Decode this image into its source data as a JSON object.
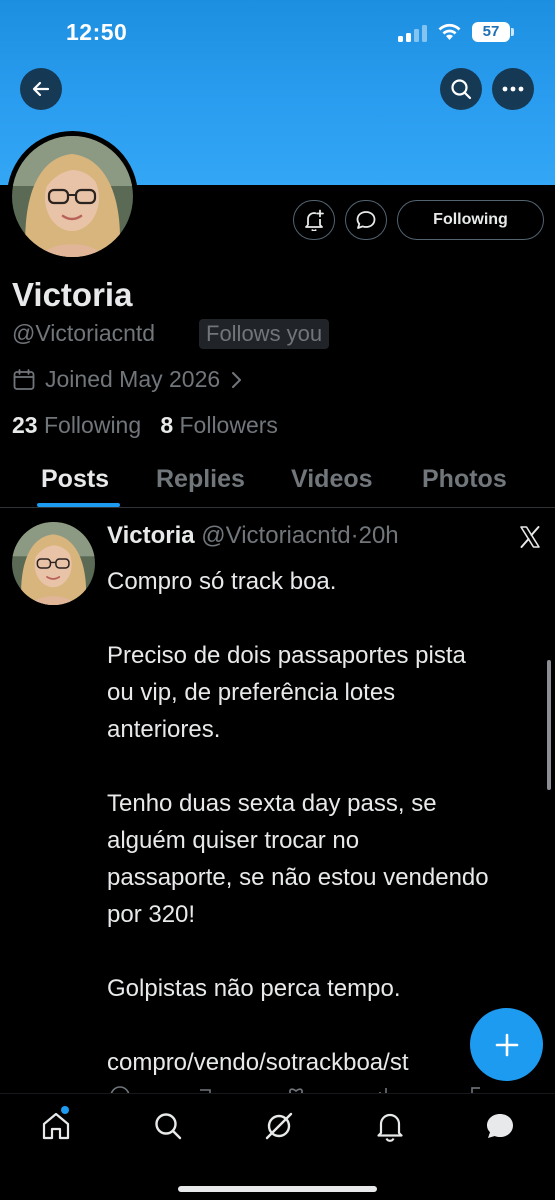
{
  "status_bar": {
    "time": "12:50",
    "battery": "57"
  },
  "header": {
    "back_icon": "arrow-left-icon",
    "search_icon": "search-icon",
    "more_icon": "more-horizontal-icon"
  },
  "profile": {
    "name": "Victoria",
    "handle": "@Victoriacntd",
    "follows_you": "Follows you",
    "joined": "Joined May 2026",
    "following_count": "23",
    "following_label": "Following",
    "followers_count": "8",
    "followers_label": "Followers",
    "follow_button": "Following",
    "notify_icon": "bell-plus-icon",
    "message_icon": "message-bubble-icon"
  },
  "tabs": [
    {
      "label": "Posts",
      "active": true
    },
    {
      "label": "Replies",
      "active": false
    },
    {
      "label": "Videos",
      "active": false
    },
    {
      "label": "Photos",
      "active": false
    }
  ],
  "post": {
    "name": "Victoria",
    "handle": "@Victoriacntd",
    "separator": "·",
    "time": "20h",
    "lines": [
      "Compro só track boa.",
      "",
      "Preciso de dois passaportes pista",
      "ou vip, de preferência lotes",
      "anteriores.",
      "",
      "Tenho duas sexta day pass, se",
      "alguém quiser trocar no",
      "passaporte, se não estou vendendo",
      "por 320!",
      "",
      "Golpistas não perca tempo.",
      "",
      "compro/vendo/sotrackboa/st"
    ]
  },
  "bottom_nav": [
    {
      "name": "home-icon",
      "badge": true
    },
    {
      "name": "search-icon",
      "badge": false
    },
    {
      "name": "grok-icon",
      "badge": false
    },
    {
      "name": "notifications-icon",
      "badge": false
    },
    {
      "name": "messages-icon",
      "badge": false
    }
  ],
  "colors": {
    "accent": "#1d9bf0",
    "banner": "#2a9df0",
    "muted": "#71767b",
    "text": "#e7e9ea",
    "background": "#000000"
  }
}
